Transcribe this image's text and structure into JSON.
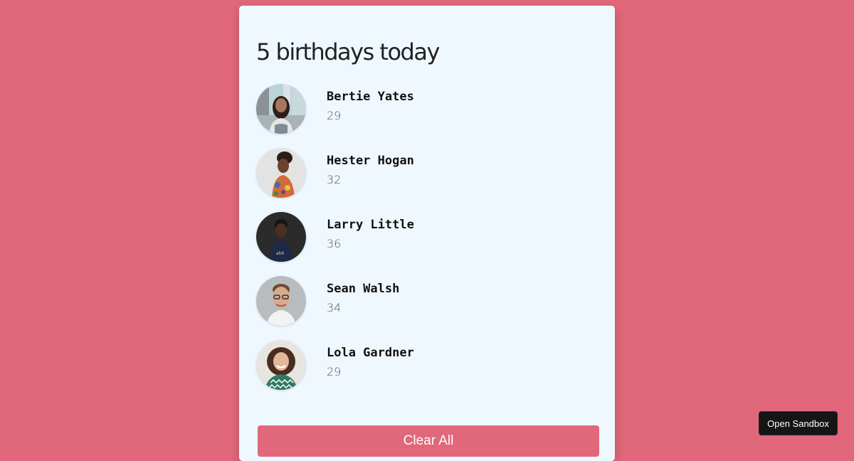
{
  "title": "5 birthdays today",
  "people": [
    {
      "name": "Bertie Yates",
      "age": "29"
    },
    {
      "name": "Hester Hogan",
      "age": "32"
    },
    {
      "name": "Larry Little",
      "age": "36"
    },
    {
      "name": "Sean Walsh",
      "age": "34"
    },
    {
      "name": "Lola Gardner",
      "age": "29"
    }
  ],
  "clear_button_label": "Clear All",
  "sandbox_button_label": "Open Sandbox",
  "colors": {
    "background": "#e1687a",
    "card": "#f0f8ff",
    "accent": "#e1687a"
  }
}
